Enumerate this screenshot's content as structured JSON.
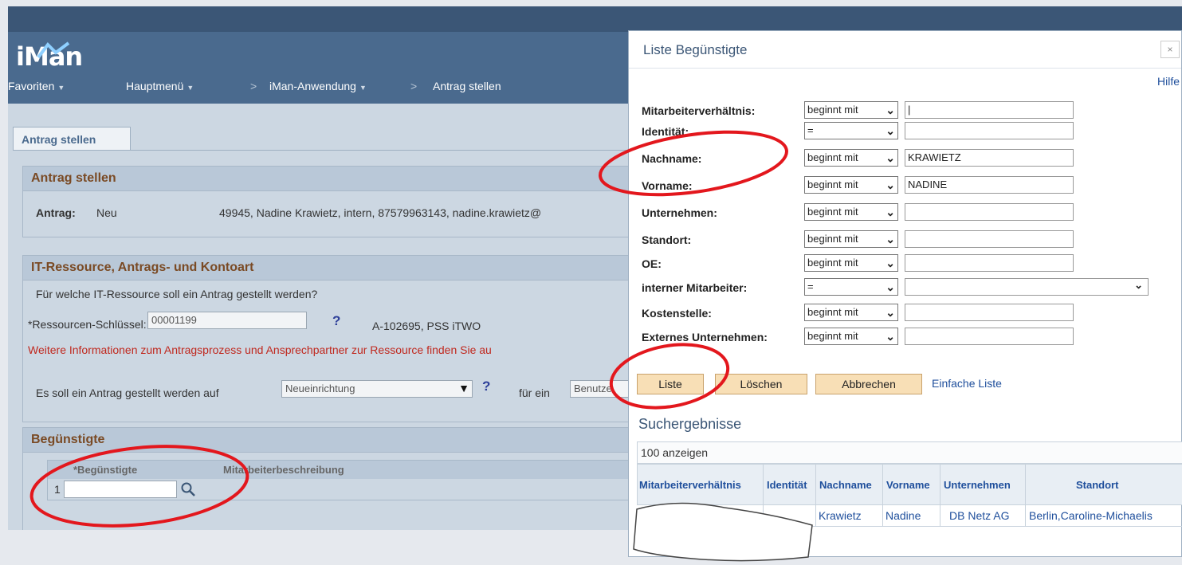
{
  "header": {
    "logo": "iMan",
    "nav": {
      "favoriten": "Favoriten",
      "hauptmenu": "Hauptmenü",
      "sep1": ">",
      "anwendung": "iMan-Anwendung",
      "sep2": ">",
      "current": "Antrag stellen"
    }
  },
  "tab": {
    "label": "Antrag stellen"
  },
  "antrag_section": {
    "title": "Antrag stellen",
    "label": "Antrag:",
    "status": "Neu",
    "info": "49945, Nadine Krawietz, intern, 87579963143, nadine.krawietz@"
  },
  "it_section": {
    "title": "IT-Ressource, Antrags- und Kontoart",
    "question": "Für welche IT-Ressource soll ein Antrag gestellt werden?",
    "key_label": "*Ressourcen-Schlüssel:",
    "key_value": "00001199",
    "help": "?",
    "resource_desc": "A-102695, PSS iTWO",
    "info_text": "Weitere Informationen zum Antragsprozess und Ansprechpartner zur Ressource finden Sie au",
    "type_prefix": "Es soll ein Antrag gestellt werden auf",
    "type_value": "Neueinrichtung",
    "fuer_ein": "für ein",
    "account_value": "Benutze"
  },
  "beg_section": {
    "title": "Begünstigte",
    "col1": "*Begünstigte",
    "col2": "Mitarbeiterbeschreibung",
    "row_num": "1",
    "value": ""
  },
  "dialog": {
    "title": "Liste Begünstigte",
    "close": "×",
    "hilfe": "Hilfe",
    "fields": [
      {
        "label": "Mitarbeiterverhältnis:",
        "op": "beginnt mit",
        "value": "|"
      },
      {
        "label": "Identität:",
        "op": "=",
        "value": ""
      },
      {
        "label": "Nachname:",
        "op": "beginnt mit",
        "value": "KRAWIETZ"
      },
      {
        "label": "Vorname:",
        "op": "beginnt mit",
        "value": "NADINE"
      },
      {
        "label": "Unternehmen:",
        "op": "beginnt mit",
        "value": ""
      },
      {
        "label": "Standort:",
        "op": "beginnt mit",
        "value": ""
      },
      {
        "label": "OE:",
        "op": "beginnt mit",
        "value": ""
      },
      {
        "label": "interner Mitarbeiter:",
        "op": "=",
        "value": ""
      },
      {
        "label": "Kostenstelle:",
        "op": "beginnt mit",
        "value": ""
      },
      {
        "label": "Externes Unternehmen:",
        "op": "beginnt mit",
        "value": ""
      }
    ],
    "buttons": {
      "liste": "Liste",
      "loeschen": "Löschen",
      "abbrechen": "Abbrechen",
      "einfach": "Einfache Liste"
    },
    "results": {
      "title": "Suchergebnisse",
      "count": "100 anzeigen",
      "headers": [
        "Mitarbeiterverhältnis",
        "Identität",
        "Nachname",
        "Vorname",
        "Unternehmen",
        "Standort"
      ],
      "row": [
        "",
        "",
        "Krawietz",
        "Nadine",
        "DB Netz AG",
        "Berlin,Caroline-Michaelis"
      ]
    }
  },
  "icons": {
    "dropdown": "chevron-down-icon",
    "search": "search-icon"
  },
  "colors": {
    "header": "#4a6a8e",
    "section_title": "#7a4a24",
    "annotation": "#e3171d",
    "button": "#f8dfb6"
  }
}
